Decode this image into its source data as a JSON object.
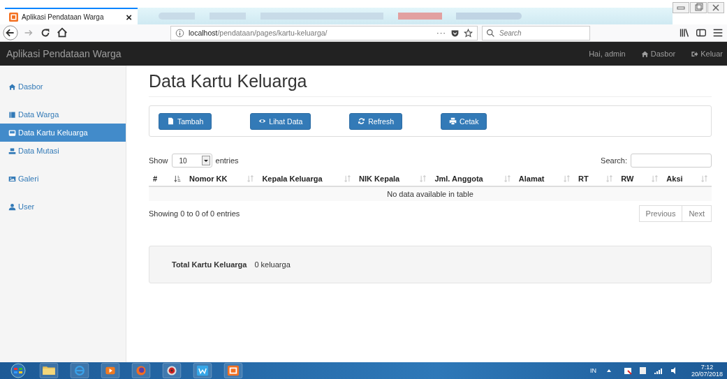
{
  "browser": {
    "tab_title": "Aplikasi Pendataan Warga",
    "tab_close": "×",
    "url_host": "localhost",
    "url_path": "/pendataan/pages/kartu-keluarga/",
    "url_more": "···",
    "search_placeholder": "Search"
  },
  "app": {
    "brand": "Aplikasi Pendataan Warga",
    "greeting": "Hai, admin",
    "links": [
      {
        "label": "Dasbor"
      },
      {
        "label": "Keluar"
      }
    ]
  },
  "sidebar": {
    "groups": [
      [
        {
          "label": "Dasbor",
          "selected": false
        }
      ],
      [
        {
          "label": "Data Warga",
          "selected": false
        },
        {
          "label": "Data Kartu Keluarga",
          "selected": true
        },
        {
          "label": "Data Mutasi",
          "selected": false
        }
      ],
      [
        {
          "label": "Galeri",
          "selected": false
        }
      ],
      [
        {
          "label": "User",
          "selected": false
        }
      ]
    ]
  },
  "page_title": "Data Kartu Keluarga",
  "buttons": [
    {
      "label": "Tambah"
    },
    {
      "label": "Lihat Data"
    },
    {
      "label": "Refresh"
    },
    {
      "label": "Cetak"
    }
  ],
  "table": {
    "show_label": "Show",
    "length": "10",
    "entries_label": "entries",
    "search_label": "Search:",
    "columns": [
      {
        "label": "#",
        "sorted": true
      },
      {
        "label": "Nomor KK",
        "sorted": false
      },
      {
        "label": "Kepala Keluarga",
        "sorted": false
      },
      {
        "label": "NIK Kepala",
        "sorted": false
      },
      {
        "label": "Jml. Anggota",
        "sorted": false
      },
      {
        "label": "Alamat",
        "sorted": false
      },
      {
        "label": "RT",
        "sorted": false
      },
      {
        "label": "RW",
        "sorted": false
      },
      {
        "label": "Aksi",
        "sorted": false
      }
    ],
    "empty_text": "No data available in table",
    "info": "Showing 0 to 0 of 0 entries",
    "pagination": [
      {
        "label": "Previous",
        "disabled": true
      },
      {
        "label": "Next",
        "disabled": true
      }
    ]
  },
  "summary": {
    "label": "Total Kartu Keluarga",
    "value": "0 keluarga"
  },
  "taskbar": {
    "language": "IN",
    "time": "7:12",
    "date": "20/07/2018"
  }
}
